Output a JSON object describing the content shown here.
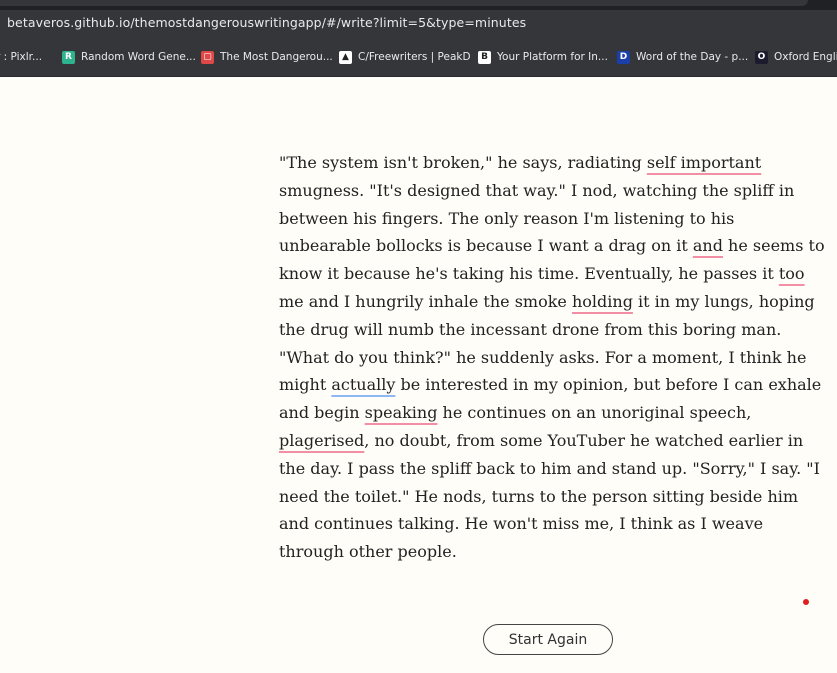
{
  "browser": {
    "url": "betaveros.github.io/themostdangerouswritingapp/#/write?limit=5&type=minutes",
    "bookmarks": [
      {
        "label": "r : Pixlr...",
        "icon": "pixlr-icon",
        "color": "#35363a"
      },
      {
        "label": "Random Word Gene...",
        "icon": "random-word-icon",
        "color": "#2fb38e",
        "glyph": "R"
      },
      {
        "label": "The Most Dangerou...",
        "icon": "dangerous-app-icon",
        "color": "#e04848",
        "glyph": "▢"
      },
      {
        "label": "C/Freewriters | PeakD",
        "icon": "peakd-icon",
        "color": "#ffffff",
        "glyph": "▲"
      },
      {
        "label": "Your Platform for In...",
        "icon": "platform-icon",
        "color": "#ffffff",
        "glyph": "B"
      },
      {
        "label": "Word of the Day - p...",
        "icon": "dictionary-icon",
        "color": "#1a3fa8",
        "glyph": "D"
      },
      {
        "label": "Oxford English",
        "icon": "oxford-icon",
        "color": "#1b1b2e",
        "glyph": "O"
      }
    ]
  },
  "essay": {
    "lines": [
      [
        {
          "t": "\"The system isn't broken,\" he says, radiating "
        },
        {
          "t": "self important",
          "s": "red"
        }
      ],
      [
        {
          "t": "smugness. \"It's designed that way.\" I nod, watching the spliff in"
        }
      ],
      [
        {
          "t": "between his fingers. The only reason I'm listening to his"
        }
      ],
      [
        {
          "t": "unbearable bollocks is because I want a drag on it "
        },
        {
          "t": "and",
          "s": "red"
        },
        {
          "t": " he seems to"
        }
      ],
      [
        {
          "t": "know it because he's taking his time. Eventually, he passes it "
        },
        {
          "t": "too",
          "s": "red"
        }
      ],
      [
        {
          "t": "me and I hungrily inhale the smoke "
        },
        {
          "t": "holding",
          "s": "red"
        },
        {
          "t": " it in my lungs, hoping"
        }
      ],
      [
        {
          "t": "the drug will numb the incessant drone from this boring man."
        }
      ],
      [
        {
          "t": "\"What do you think?\" he suddenly asks. For a moment, I think he"
        }
      ],
      [
        {
          "t": "might "
        },
        {
          "t": "actually",
          "s": "blue"
        },
        {
          "t": " be interested in my opinion, but before I can exhale"
        }
      ],
      [
        {
          "t": "and begin "
        },
        {
          "t": "speaking",
          "s": "red"
        },
        {
          "t": " he continues on an unoriginal speech,"
        }
      ],
      [
        {
          "t": "plagerised",
          "s": "red"
        },
        {
          "t": ", no doubt, from some YouTuber he watched earlier in"
        }
      ],
      [
        {
          "t": "the day. I pass the spliff back to him and stand up. \"Sorry,\" I say. \"I"
        }
      ],
      [
        {
          "t": "need the toilet.\" He nods, turns to the person sitting beside him"
        }
      ],
      [
        {
          "t": "and continues talking. He won't miss me, I think as I weave"
        }
      ],
      [
        {
          "t": "through other people."
        }
      ]
    ]
  },
  "actions": {
    "start_again_label": "Start Again"
  },
  "colors": {
    "spell_error": "#f28fa5",
    "grammar_hint": "#8fb8f2",
    "timer_dot": "#dd1f1f"
  }
}
